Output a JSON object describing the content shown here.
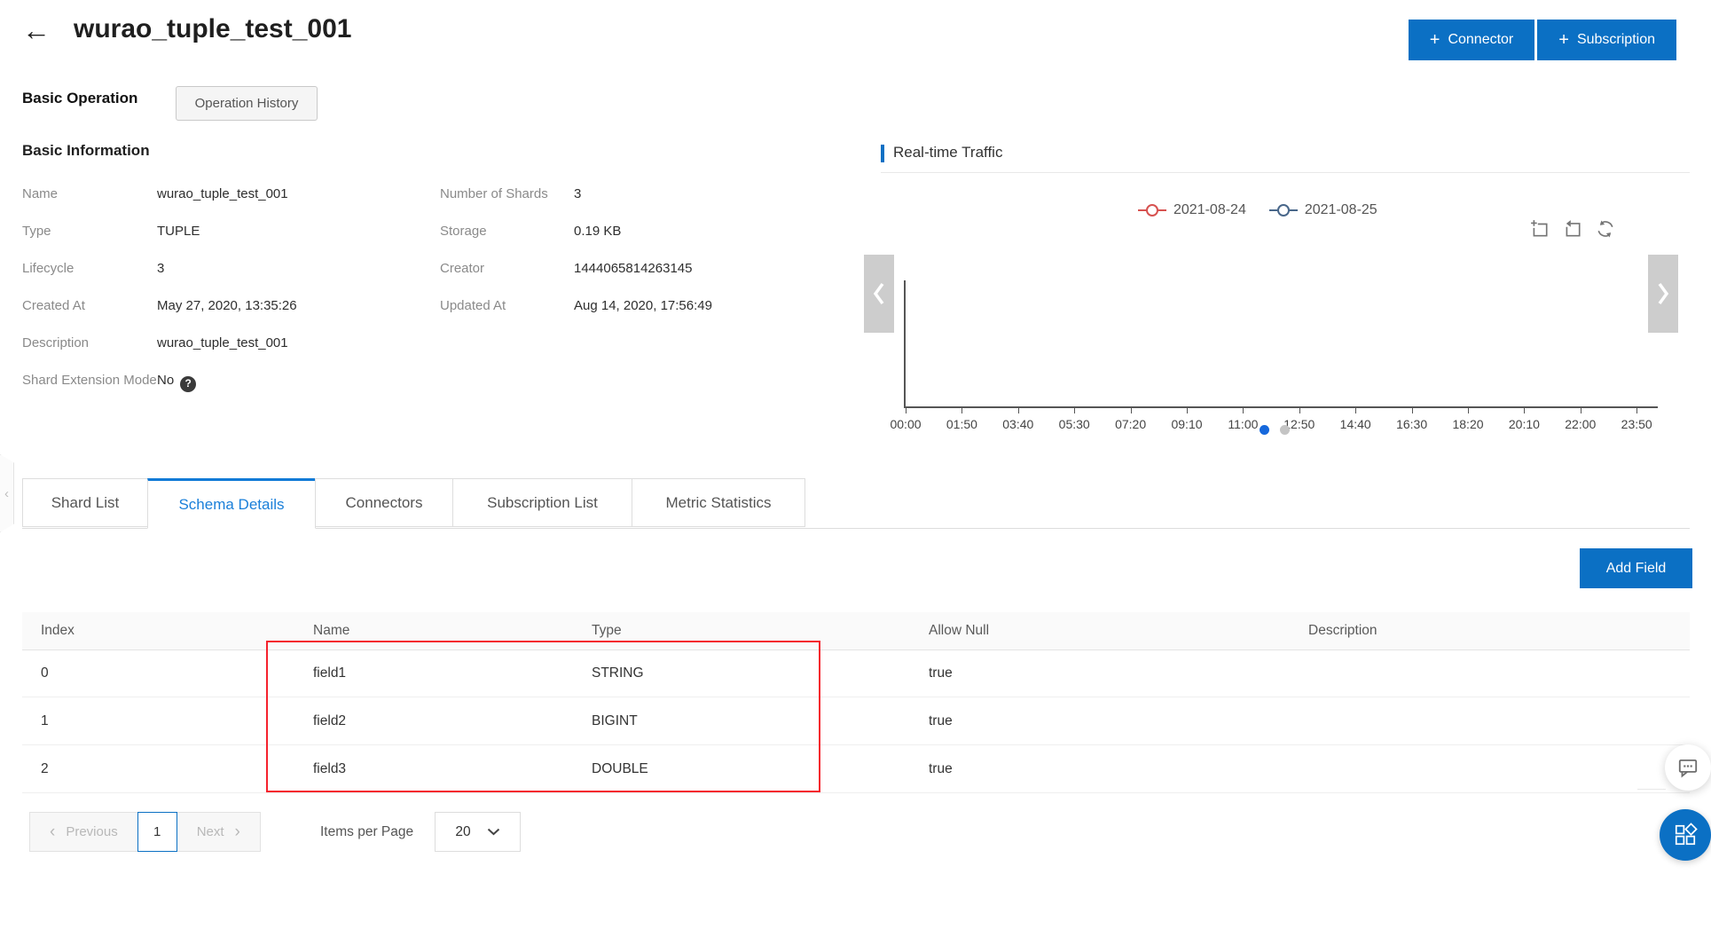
{
  "header": {
    "back_icon": "←",
    "title": "wurao_tuple_test_001",
    "plus_icon": "+",
    "connector_label": "Connector",
    "subscription_label": "Subscription"
  },
  "operation_tabs": {
    "basic_operation": "Basic Operation",
    "operation_history": "Operation History"
  },
  "basic_information": {
    "heading": "Basic Information",
    "fields_left": [
      {
        "label": "Name",
        "value": "wurao_tuple_test_001"
      },
      {
        "label": "Type",
        "value": "TUPLE"
      },
      {
        "label": "Lifecycle",
        "value": "3"
      },
      {
        "label": "Created At",
        "value": "May 27, 2020, 13:35:26"
      },
      {
        "label": "Description",
        "value": "wurao_tuple_test_001"
      },
      {
        "label": "Shard Extension Mode",
        "value": "No",
        "has_help_icon": true,
        "help_icon": "?"
      }
    ],
    "fields_right": [
      {
        "label": "Number of Shards",
        "value": "3"
      },
      {
        "label": "Storage",
        "value": "0.19 KB"
      },
      {
        "label": "Creator",
        "value": "1444065814263145"
      },
      {
        "label": "Updated At",
        "value": "Aug 14, 2020, 17:56:49"
      }
    ]
  },
  "traffic_panel": {
    "title": "Real-time Traffic",
    "accent_color": "#0b70c4",
    "chart_data": {
      "type": "line",
      "series": [
        {
          "name": "2021-08-24",
          "color": "#d75250",
          "values": []
        },
        {
          "name": "2021-08-25",
          "color": "#49678a",
          "values": []
        }
      ],
      "x_ticks": [
        "00:00",
        "01:50",
        "03:40",
        "05:30",
        "07:20",
        "09:10",
        "11:00",
        "12:50",
        "14:40",
        "16:30",
        "18:20",
        "20:10",
        "22:00",
        "23:50"
      ],
      "legend_position": "top",
      "grid": false
    },
    "toolbox_icons": [
      "zoom-select-icon",
      "restore-icon",
      "refresh-icon"
    ],
    "carousel": {
      "prev_icon": "‹",
      "next_icon": "›",
      "dots_count": 2,
      "active_dot_index": 0
    }
  },
  "side_handle_icon": "‹",
  "detail_tabs": [
    {
      "label": "Shard List",
      "active": false
    },
    {
      "label": "Schema Details",
      "active": true
    },
    {
      "label": "Connectors",
      "active": false
    },
    {
      "label": "Subscription List",
      "active": false
    },
    {
      "label": "Metric Statistics",
      "active": false
    }
  ],
  "schema": {
    "add_field_label": "Add Field",
    "table": {
      "columns": [
        "Index",
        "Name",
        "Type",
        "Allow Null",
        "Description"
      ],
      "rows": [
        [
          "0",
          "field1",
          "STRING",
          "true",
          ""
        ],
        [
          "1",
          "field2",
          "BIGINT",
          "true",
          ""
        ],
        [
          "2",
          "field3",
          "DOUBLE",
          "true",
          ""
        ]
      ]
    },
    "annotation": {
      "highlight_box_color": "#f5222d",
      "highlighted_columns": [
        "Name",
        "Type"
      ]
    }
  },
  "pagination": {
    "prev_icon": "‹",
    "previous_label": "Previous",
    "page": "1",
    "next_label": "Next",
    "next_icon": "›",
    "items_per_page_label": "Items per Page",
    "page_size": "20"
  },
  "colors": {
    "primary_blue": "#0b70c4",
    "tab_active_blue": "#1a7fd9",
    "annotation_red": "#f5222d",
    "series_red": "#d75250",
    "series_slate": "#49678a"
  }
}
